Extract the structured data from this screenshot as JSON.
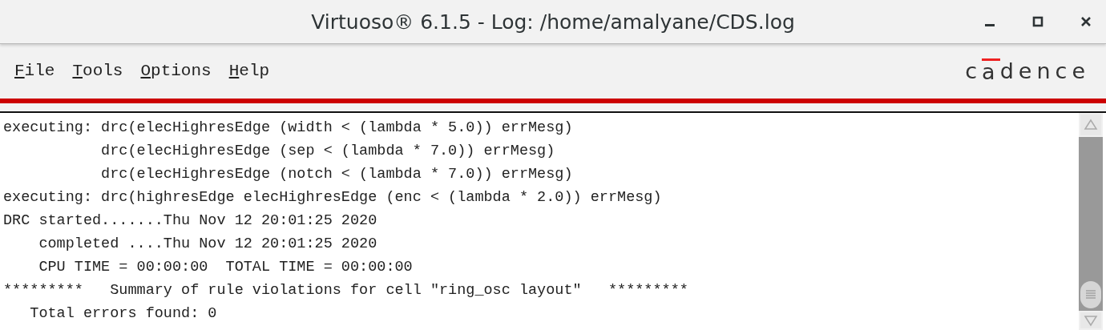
{
  "window": {
    "title": "Virtuoso® 6.1.5 - Log: /home/amalyane/CDS.log"
  },
  "menu": [
    {
      "label": "File"
    },
    {
      "label": "Tools"
    },
    {
      "label": "Options"
    },
    {
      "label": "Help"
    }
  ],
  "logo": "cadence",
  "log": [
    "executing: drc(elecHighresEdge (width < (lambda * 5.0)) errMesg)",
    "           drc(elecHighresEdge (sep < (lambda * 7.0)) errMesg)",
    "           drc(elecHighresEdge (notch < (lambda * 7.0)) errMesg)",
    "executing: drc(highresEdge elecHighresEdge (enc < (lambda * 2.0)) errMesg)",
    "DRC started.......Thu Nov 12 20:01:25 2020",
    "    completed ....Thu Nov 12 20:01:25 2020",
    "    CPU TIME = 00:00:00  TOTAL TIME = 00:00:00",
    "*********   Summary of rule violations for cell \"ring_osc layout\"   *********",
    "   Total errors found: 0"
  ]
}
